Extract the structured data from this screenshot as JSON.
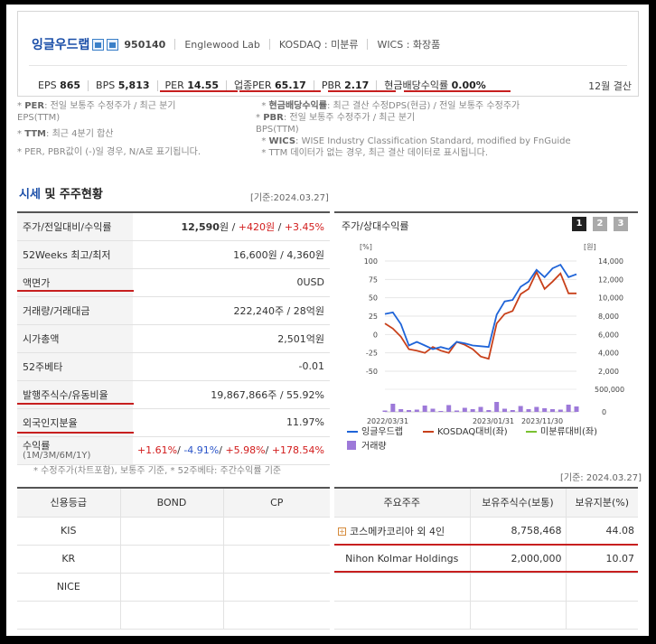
{
  "company": {
    "name": "잉글우드랩",
    "code": "950140",
    "eng_name": "Englewood Lab",
    "market": "KOSDAQ : 미분류",
    "wics": "WICS : 화장품"
  },
  "stats": [
    {
      "label": "EPS",
      "value": "865"
    },
    {
      "label": "BPS",
      "value": "5,813"
    },
    {
      "label": "PER",
      "value": "14.55"
    },
    {
      "label": "업종PER",
      "value": "65.17"
    },
    {
      "label": "PBR",
      "value": "2.17"
    },
    {
      "label": "현금배당수익률",
      "value": "0.00%"
    }
  ],
  "settlement": "12월 결산",
  "notes": {
    "per_key": "PER",
    "per_text": ": 전일 보통주 수정주가 / 최근 분기",
    "per_cont": "EPS(TTM)",
    "ttm_key": "TTM",
    "ttm_text": ": 최근 4분기 합산",
    "na_note": "* PER, PBR값이 (-)일 경우, N/A로 표기됩니다.",
    "div_key": "현금배당수익률",
    "div_text": ": 최근 결산 수정DPS(현금) / 전일 보통주 수정주가",
    "pbr_key": "PBR",
    "pbr_text": ": 전일 보통주 수정주가 / 최근 분기",
    "pbr_cont": "BPS(TTM)",
    "wics_key": "WICS",
    "wics_text": ": WISE Industry Classification Standard, modified by FnGuide",
    "ttm_missing": "* TTM 데이터가 없는 경우, 최근 결산 데이터로 표시됩니다."
  },
  "section": {
    "title_blue": "시세",
    "title_rest": " 및 주주현황",
    "date": "[기준:2024.03.27]"
  },
  "quote": {
    "price_label": "주가/전일대비/수익률",
    "price": "12,590",
    "price_unit": "원 / ",
    "change": "+420원",
    "sep": " / ",
    "pct": "+3.45%",
    "w52_label": "52Weeks 최고/최저",
    "w52": "16,600원 / 4,360원",
    "par_label": "액면가",
    "par": "0USD",
    "vol_label": "거래량/거래대금",
    "vol": "222,240주 / 28억원",
    "cap_label": "시가총액",
    "cap": "2,501억원",
    "beta_label": "52주베타",
    "beta": "-0.01",
    "shares_label": "발행주식수/유동비율",
    "shares": "19,867,866주 / 55.92%",
    "foreign_label": "외국인지분율",
    "foreign": "11.97%",
    "ret_label": "수익률",
    "ret_sub": "(1M/3M/6M/1Y)",
    "r1": "+1.61%",
    "r2": "-4.91%",
    "r3": "+5.98%",
    "r4": "+178.54%"
  },
  "quote_note": "* 수정주가(차트포함), 보통주 기준, * 52주베타: 주간수익률 기준",
  "chart_title": "주가/상대수익률",
  "chart_pages": [
    "1",
    "2",
    "3"
  ],
  "chart_data": {
    "type": "line",
    "x_ticks": [
      "2022/03/31",
      "2023/01/31",
      "2023/11/30"
    ],
    "left_unit": "[%]",
    "right_unit": "[원]",
    "left_ticks": [
      100,
      75,
      50,
      25,
      0,
      -25,
      -50
    ],
    "right_ticks": [
      "14,000",
      "12,000",
      "10,000",
      "8,000",
      "6,000",
      "4,000",
      "2,000"
    ],
    "vol_ticks": [
      "500,000",
      "0"
    ],
    "ylim": [
      -50,
      100
    ],
    "series": [
      {
        "name": "잉글우드랩",
        "color": "#1f64d8",
        "values": [
          28,
          30,
          14,
          -15,
          -10,
          -15,
          -20,
          -17,
          -20,
          -10,
          -12,
          -15,
          -16,
          -17,
          27,
          45,
          47,
          65,
          72,
          88,
          78,
          90,
          95,
          78,
          82
        ]
      },
      {
        "name": "KOSDAQ대비(좌)",
        "color": "#c8401a",
        "values": [
          15,
          8,
          -3,
          -20,
          -22,
          -25,
          -17,
          -22,
          -25,
          -10,
          -14,
          -20,
          -30,
          -33,
          15,
          28,
          32,
          55,
          62,
          85,
          62,
          72,
          83,
          56,
          56
        ]
      },
      {
        "name": "미분류대비(좌)",
        "color": "#7ac131",
        "values": []
      },
      {
        "name": "거래량",
        "color": "#9d79d9",
        "values": [
          30,
          180,
          60,
          40,
          50,
          140,
          70,
          20,
          150,
          30,
          90,
          60,
          110,
          40,
          220,
          70,
          40,
          130,
          60,
          110,
          80,
          60,
          50,
          160,
          120
        ]
      }
    ]
  },
  "share_date": "[기준: 2024.03.27]",
  "credit": {
    "headers": [
      "신용등급",
      "BOND",
      "CP"
    ],
    "rows": [
      [
        "KIS",
        "",
        ""
      ],
      [
        "KR",
        "",
        ""
      ],
      [
        "NICE",
        "",
        ""
      ],
      [
        "",
        "",
        ""
      ]
    ]
  },
  "holders": {
    "headers": [
      "주요주주",
      "보유주식수(보통)",
      "보유지분(%)"
    ],
    "rows": [
      [
        "코스메카코리아 외 4인",
        "8,758,468",
        "44.08"
      ],
      [
        "Nihon Kolmar Holdings",
        "2,000,000",
        "10.07"
      ],
      [
        "",
        "",
        ""
      ],
      [
        "",
        "",
        ""
      ]
    ]
  }
}
